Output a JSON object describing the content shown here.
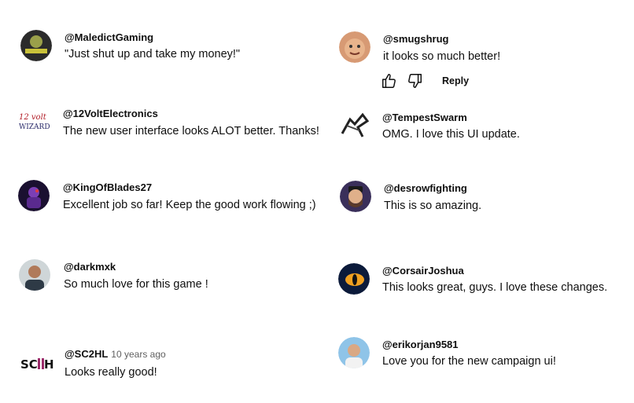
{
  "comments_left": [
    {
      "handle": "@MaledictGaming",
      "text": "\"Just shut up and take my money!\"",
      "avatar": "maledict-gaming-logo"
    },
    {
      "handle": "@12VoltElectronics",
      "text": "The new user interface looks ALOT better. Thanks!",
      "avatar": "12volt-wizard-logo",
      "logo_text": "12 volt WIZARD"
    },
    {
      "handle": "@KingOfBlades27",
      "text": "Excellent job so far! Keep the good work flowing ;)",
      "avatar": "purple-character-avatar"
    },
    {
      "handle": "@darkmxk",
      "text": "So much love for this game !",
      "avatar": "man-photo-avatar"
    },
    {
      "handle": "@SC2HL",
      "time": "10 years ago",
      "text": "Looks really good!",
      "avatar": "sc2hl-logo",
      "logo_text": "SC2HL"
    }
  ],
  "comments_right": [
    {
      "handle": "@smugshrug",
      "text": "it looks so much better!",
      "avatar": "cartoon-face-avatar"
    },
    {
      "handle": "@TempestSwarm",
      "text": "OMG. I love this UI update.",
      "avatar": "swarm-creature-avatar"
    },
    {
      "handle": "@desrowfighting",
      "text": "This is so amazing.",
      "avatar": "bearded-character-avatar"
    },
    {
      "handle": "@CorsairJoshua",
      "text": "This looks great, guys. I love these changes.",
      "avatar": "dragon-eye-avatar"
    },
    {
      "handle": "@erikorjan9581",
      "text": "Love you for the new campaign ui!",
      "avatar": "man-outdoor-avatar"
    }
  ],
  "actions": {
    "like_icon": "thumbs-up-icon",
    "dislike_icon": "thumbs-down-icon",
    "reply_label": "Reply"
  }
}
